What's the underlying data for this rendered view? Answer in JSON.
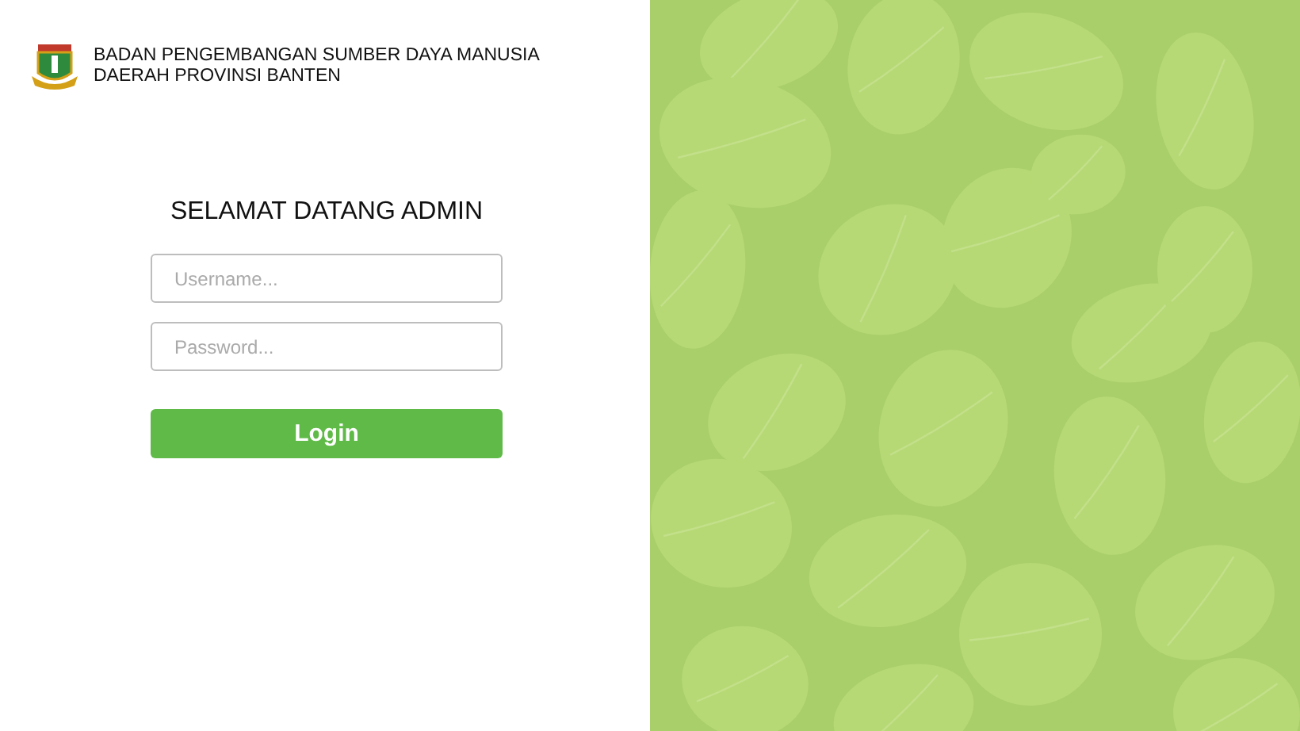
{
  "header": {
    "org_name_lines": [
      "BADAN PENGEMBANGAN SUMBER DAYA MANUSIA",
      "DAERAH PROVINSI BANTEN"
    ]
  },
  "login": {
    "heading": "SELAMAT DATANG ADMIN",
    "username": {
      "placeholder": "Username..."
    },
    "password": {
      "placeholder": "Password..."
    },
    "button": "Login"
  }
}
